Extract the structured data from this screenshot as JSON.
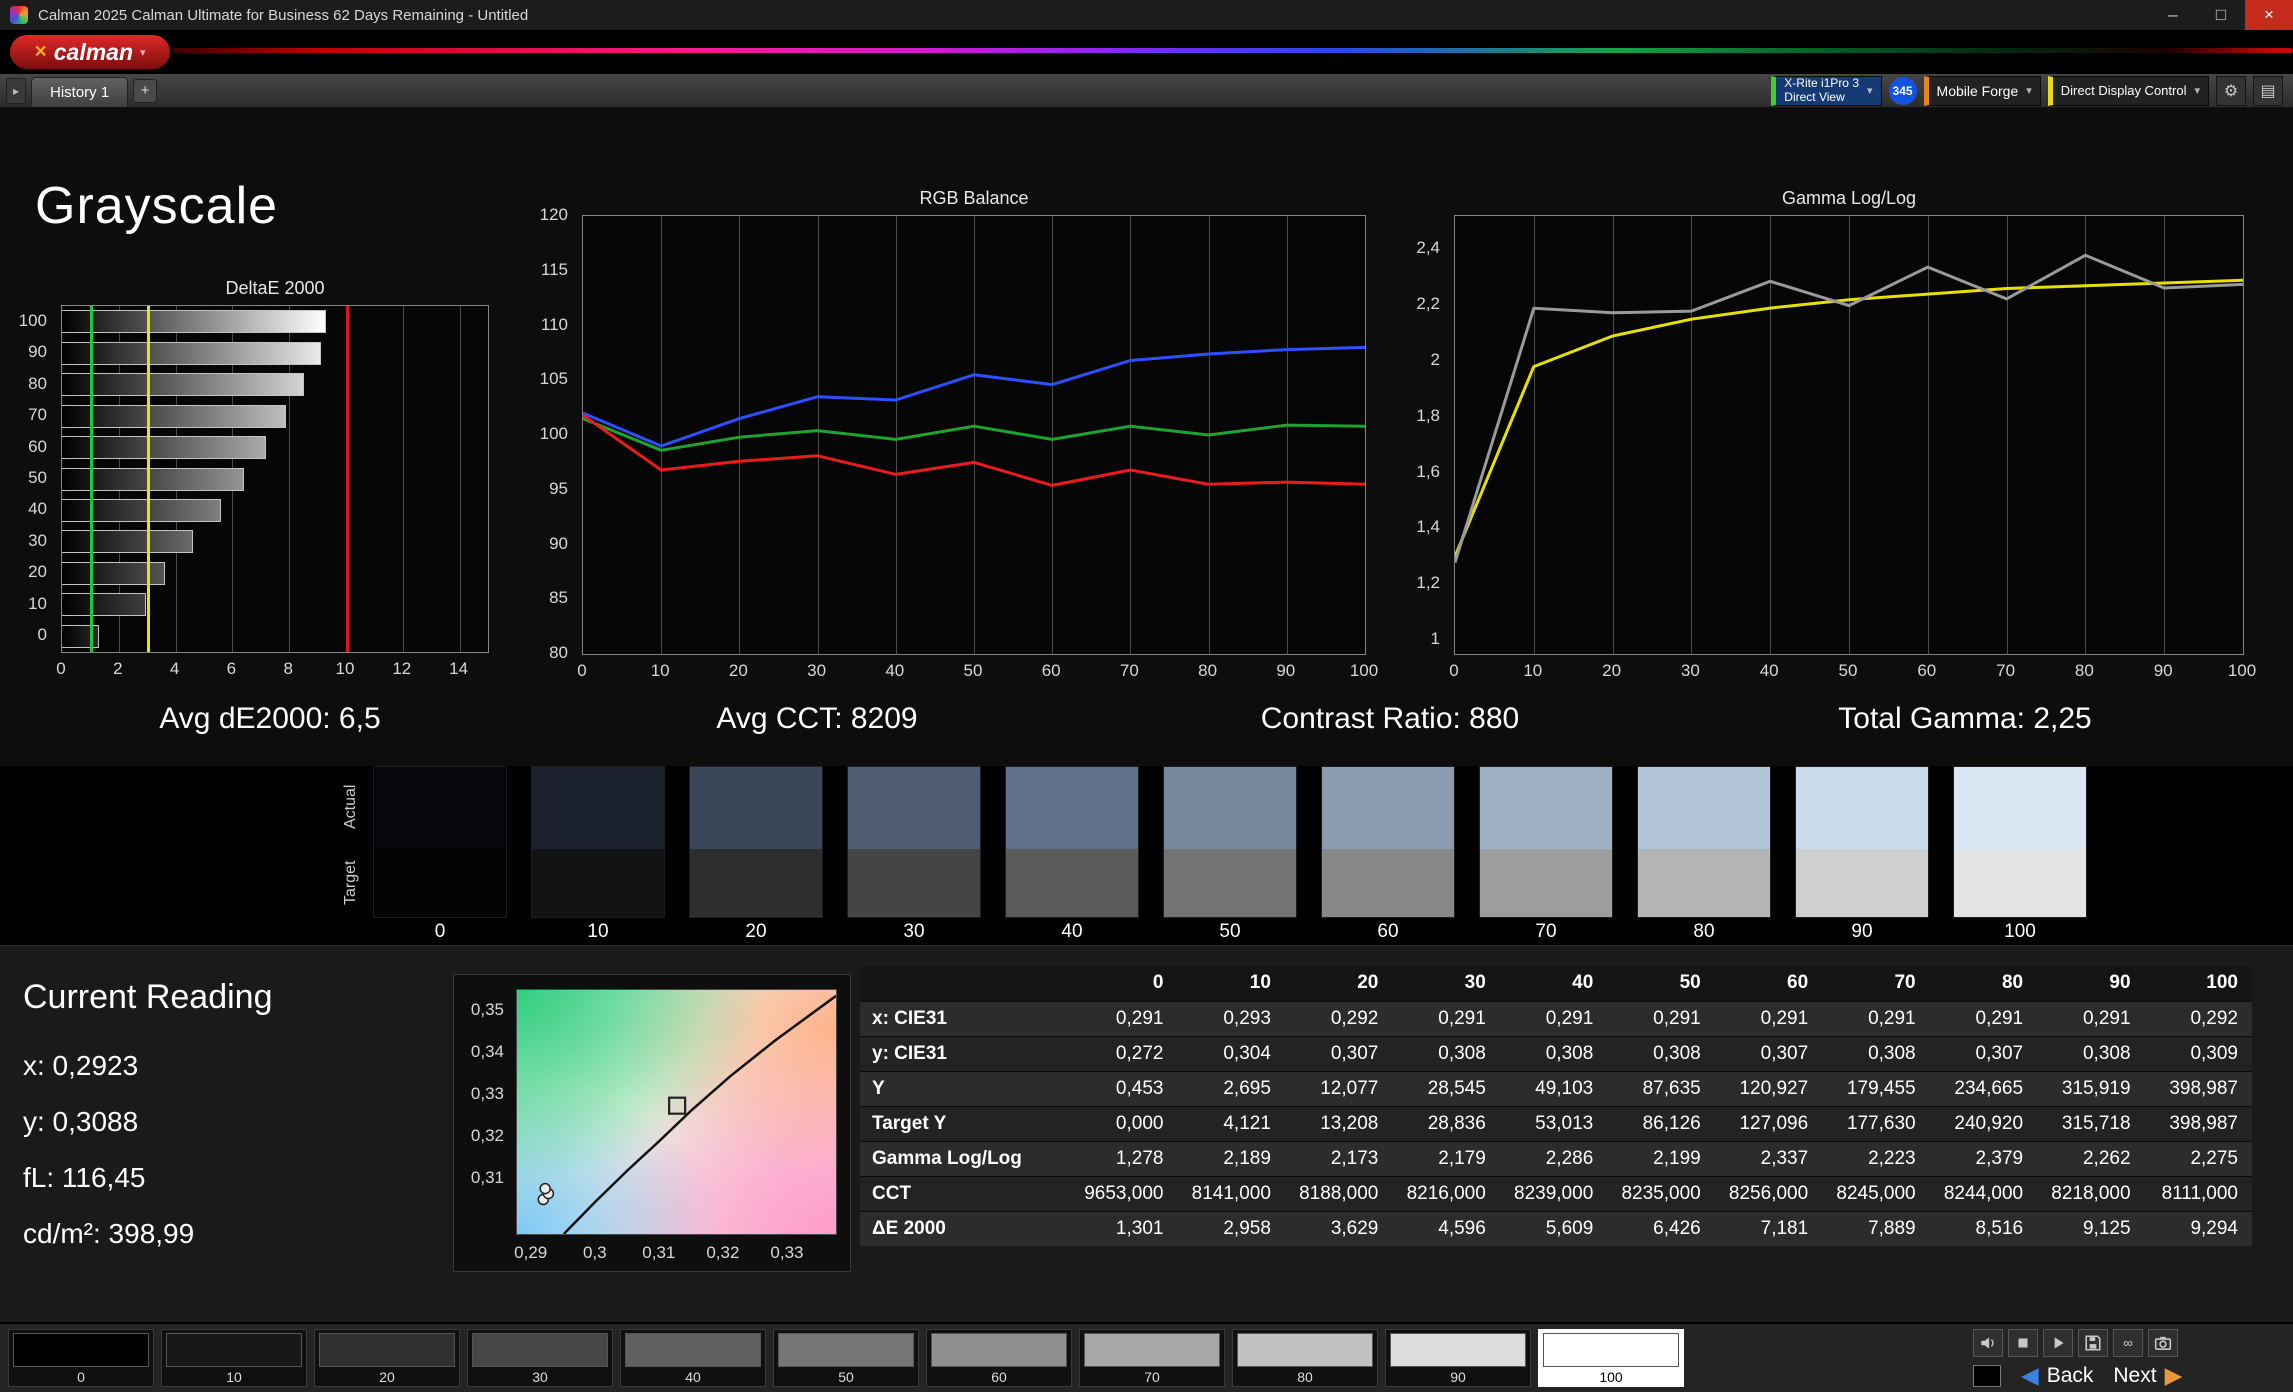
{
  "window": {
    "title": "Calman 2025 Calman Ultimate for Business 62 Days Remaining  - Untitled",
    "minimize": "–",
    "maximize": "□",
    "close": "×"
  },
  "brand": {
    "name": "calman",
    "mark": "×",
    "chevron": "▾"
  },
  "tab_bar": {
    "scroll_icon": "▸",
    "history_tab": "History 1",
    "add_tab": "+"
  },
  "meters": {
    "meter_line1": "X-Rite i1Pro 3",
    "meter_line2": "Direct View",
    "badge": "345",
    "source": "Mobile Forge",
    "display": "Direct Display Control",
    "chevron": "▾",
    "gear_icon": "⚙",
    "panel_icon": "▤"
  },
  "page_title": "Grayscale",
  "summary": {
    "avg_de": "Avg dE2000: 6,5",
    "avg_cct": "Avg CCT: 8209",
    "contrast": "Contrast Ratio: 880",
    "total_gamma": "Total Gamma: 2,25"
  },
  "chart_data": [
    {
      "type": "bar",
      "orientation": "horizontal",
      "title": "DeltaE 2000",
      "categories": [
        100,
        90,
        80,
        70,
        60,
        50,
        40,
        30,
        20,
        10,
        0
      ],
      "values": [
        9.294,
        9.125,
        8.516,
        7.889,
        7.181,
        6.426,
        5.609,
        4.596,
        3.629,
        2.958,
        1.301
      ],
      "xlim": [
        0,
        15
      ],
      "x_ticks": [
        0,
        2,
        4,
        6,
        8,
        10,
        12,
        14
      ],
      "ref_lines": [
        {
          "name": "good",
          "value": 1,
          "color": "#22c63c"
        },
        {
          "name": "warning",
          "value": 3,
          "color": "#e6e600"
        },
        {
          "name": "bad",
          "value": 10,
          "color": "#e01414"
        }
      ]
    },
    {
      "type": "line",
      "title": "RGB Balance",
      "x": [
        0,
        10,
        20,
        30,
        40,
        50,
        60,
        70,
        80,
        90,
        100
      ],
      "ylim": [
        80,
        120
      ],
      "y_ticks": [
        120,
        115,
        110,
        105,
        100,
        95,
        90,
        85,
        80
      ],
      "series": [
        {
          "name": "Blue",
          "color": "#2b50ff",
          "values": [
            102,
            99,
            101.5,
            103.5,
            103.2,
            105.5,
            104.6,
            106.8,
            107.4,
            107.8,
            108
          ]
        },
        {
          "name": "Green",
          "color": "#1fa32f",
          "values": [
            101.5,
            98.6,
            99.8,
            100.4,
            99.6,
            100.8,
            99.6,
            100.8,
            100,
            100.9,
            100.8
          ]
        },
        {
          "name": "Red",
          "color": "#e81c1c",
          "values": [
            101.8,
            96.8,
            97.6,
            98.1,
            96.4,
            97.5,
            95.4,
            96.8,
            95.5,
            95.7,
            95.5
          ]
        }
      ]
    },
    {
      "type": "line",
      "title": "Gamma Log/Log",
      "x": [
        0,
        10,
        20,
        30,
        40,
        50,
        60,
        70,
        80,
        90,
        100
      ],
      "ylim": [
        0.95,
        2.52
      ],
      "y_ticks": [
        2.4,
        2.2,
        2,
        1.8,
        1.6,
        1.4,
        1.2,
        1
      ],
      "y_tick_labels": [
        "2,4",
        "2,2",
        "2",
        "1,8",
        "1,6",
        "1,4",
        "1,2",
        "1"
      ],
      "series": [
        {
          "name": "Target",
          "color": "#e6e000",
          "values": [
            1.3,
            1.98,
            2.09,
            2.15,
            2.19,
            2.22,
            2.24,
            2.26,
            2.27,
            2.28,
            2.29
          ]
        },
        {
          "name": "Measured",
          "color": "#9a9a9a",
          "values": [
            1.278,
            2.189,
            2.173,
            2.179,
            2.286,
            2.199,
            2.337,
            2.223,
            2.379,
            2.262,
            2.275
          ]
        }
      ]
    },
    {
      "type": "scatter",
      "title": "CIE xy chromaticity",
      "xlim": [
        0.2877,
        0.3375
      ],
      "ylim": [
        0.297,
        0.355
      ],
      "x_ticks": [
        {
          "value": 0.29,
          "label": "0,29"
        },
        {
          "value": 0.3,
          "label": "0,3"
        },
        {
          "value": 0.31,
          "label": "0,31"
        },
        {
          "value": 0.32,
          "label": "0,32"
        },
        {
          "value": 0.33,
          "label": "0,33"
        }
      ],
      "y_ticks": [
        {
          "value": 0.35,
          "label": "0,35"
        },
        {
          "value": 0.34,
          "label": "0,34"
        },
        {
          "value": 0.33,
          "label": "0,33"
        },
        {
          "value": 0.32,
          "label": "0,32"
        },
        {
          "value": 0.31,
          "label": "0,31"
        }
      ],
      "locus": [
        [
          0.295,
          0.297
        ],
        [
          0.3,
          0.3048
        ],
        [
          0.305,
          0.3122
        ],
        [
          0.31,
          0.3192
        ],
        [
          0.315,
          0.3265
        ],
        [
          0.321,
          0.3345
        ],
        [
          0.328,
          0.343
        ],
        [
          0.3375,
          0.3536
        ]
      ],
      "target": {
        "x": 0.3127,
        "y": 0.3275
      },
      "points": [
        {
          "x": 0.2918,
          "y": 0.3052
        },
        {
          "x": 0.2926,
          "y": 0.3066
        },
        {
          "x": 0.2921,
          "y": 0.3078
        }
      ]
    }
  ],
  "swatch_strip": {
    "row_labels": [
      "Actual",
      "Target"
    ],
    "levels": [
      "0",
      "10",
      "20",
      "30",
      "40",
      "50",
      "60",
      "70",
      "80",
      "90",
      "100"
    ],
    "actual_colors": [
      "#06070c",
      "#1c222e",
      "#3b4659",
      "#4e5c74",
      "#5f7089",
      "#77899f",
      "#8c9db2",
      "#9fb1c5",
      "#b3c5d8",
      "#c9dbeb",
      "#d8e6f4"
    ],
    "target_colors": [
      "#020202",
      "#131313",
      "#2e2e2e",
      "#454545",
      "#5a5a5a",
      "#737373",
      "#888888",
      "#9d9d9d",
      "#b4b4b4",
      "#cfcfcf",
      "#e3e3e3"
    ]
  },
  "current_reading": {
    "title": "Current Reading",
    "lines": [
      "x: 0,2923",
      "y: 0,3088",
      "fL: 116,45",
      "cd/m²: 398,99"
    ]
  },
  "results_table": {
    "columns": [
      "",
      "0",
      "10",
      "20",
      "30",
      "40",
      "50",
      "60",
      "70",
      "80",
      "90",
      "100"
    ],
    "rows": [
      {
        "label": "x: CIE31",
        "values": [
          "0,291",
          "0,293",
          "0,292",
          "0,291",
          "0,291",
          "0,291",
          "0,291",
          "0,291",
          "0,291",
          "0,291",
          "0,292"
        ]
      },
      {
        "label": "y: CIE31",
        "values": [
          "0,272",
          "0,304",
          "0,307",
          "0,308",
          "0,308",
          "0,308",
          "0,307",
          "0,308",
          "0,307",
          "0,308",
          "0,309"
        ]
      },
      {
        "label": "Y",
        "values": [
          "0,453",
          "2,695",
          "12,077",
          "28,545",
          "49,103",
          "87,635",
          "120,927",
          "179,455",
          "234,665",
          "315,919",
          "398,987"
        ]
      },
      {
        "label": "Target Y",
        "values": [
          "0,000",
          "4,121",
          "13,208",
          "28,836",
          "53,013",
          "86,126",
          "127,096",
          "177,630",
          "240,920",
          "315,718",
          "398,987"
        ]
      },
      {
        "label": "Gamma Log/Log",
        "values": [
          "1,278",
          "2,189",
          "2,173",
          "2,179",
          "2,286",
          "2,199",
          "2,337",
          "2,223",
          "2,379",
          "2,262",
          "2,275"
        ]
      },
      {
        "label": "CCT",
        "values": [
          "9653,000",
          "8141,000",
          "8188,000",
          "8216,000",
          "8239,000",
          "8235,000",
          "8256,000",
          "8245,000",
          "8244,000",
          "8218,000",
          "8111,000"
        ]
      },
      {
        "label": "ΔE 2000",
        "values": [
          "1,301",
          "2,958",
          "3,629",
          "4,596",
          "5,609",
          "6,426",
          "7,181",
          "7,889",
          "8,516",
          "9,125",
          "9,294"
        ]
      }
    ]
  },
  "toolbar": {
    "patch_labels": [
      "0",
      "10",
      "20",
      "30",
      "40",
      "50",
      "60",
      "70",
      "80",
      "90",
      "100"
    ],
    "patch_colors": [
      "#000000",
      "#181818",
      "#2f2f2f",
      "#474747",
      "#5f5f5f",
      "#777777",
      "#909090",
      "#a8a8a8",
      "#c2c2c2",
      "#dddddd",
      "#ffffff"
    ],
    "selected_index": 10,
    "mini_icons": [
      "speaker",
      "stop",
      "play",
      "save",
      "loop",
      "camera"
    ],
    "back": "Back",
    "next": "Next",
    "back_arrow": "◀",
    "next_arrow": "▶"
  }
}
